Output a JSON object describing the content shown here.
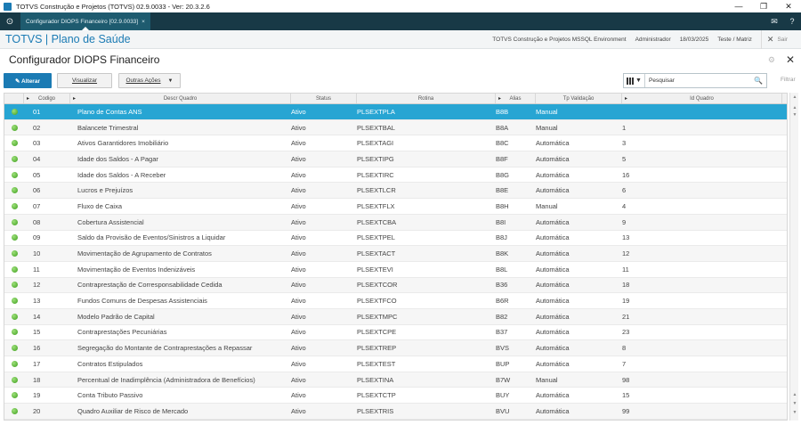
{
  "window": {
    "title": "TOTVS Construção e Projetos (TOTVS) 02.9.0033 - Ver: 20.3.2.6",
    "minimize": "—",
    "maximize": "❐",
    "close": "✕"
  },
  "tabbar": {
    "home_glyph": "⊙",
    "tab_label": "Configurador DIOPS Financeiro [02.9.0033]",
    "tab_close": "×",
    "mail_glyph": "✉",
    "help_glyph": "?"
  },
  "appbar": {
    "brand": "TOTVS | Plano de Saúde",
    "environment": "TOTVS Construção e Projetos MSSQL Environment",
    "user": "Administrador",
    "date": "18/03/2025",
    "branch": "Teste / Matriz",
    "exit_glyph": "✕",
    "exit_label": "Sair"
  },
  "page": {
    "title": "Configurador DIOPS Financeiro",
    "gear_glyph": "⚙",
    "close_glyph": "✕"
  },
  "toolbar": {
    "alterar": "✎ Alterar",
    "visualizar": "Visualizar",
    "outras_acoes": "Outras Ações",
    "caret": "▼",
    "search_placeholder": "Pesquisar",
    "search_glyph": "🔍",
    "filtrar": "Filtrar"
  },
  "grid": {
    "headers": {
      "codigo": "Codigo",
      "descr": "Descr Quadro",
      "status": "Status",
      "rotina": "Rotina",
      "alias": "Alias",
      "tp": "Tp Validação",
      "id": "Id Quadro"
    },
    "rows": [
      {
        "codigo": "01",
        "descr": "Plano de Contas ANS",
        "status": "Ativo",
        "rotina": "PLSEXTPLA",
        "alias": "B8B",
        "tp": "Manual",
        "id": ""
      },
      {
        "codigo": "02",
        "descr": "Balancete Trimestral",
        "status": "Ativo",
        "rotina": "PLSEXTBAL",
        "alias": "B8A",
        "tp": "Manual",
        "id": "1"
      },
      {
        "codigo": "03",
        "descr": "Ativos Garantidores Imobiliário",
        "status": "Ativo",
        "rotina": "PLSEXTAGI",
        "alias": "B8C",
        "tp": "Automática",
        "id": "3"
      },
      {
        "codigo": "04",
        "descr": "Idade dos Saldos - A Pagar",
        "status": "Ativo",
        "rotina": "PLSEXTIPG",
        "alias": "B8F",
        "tp": "Automática",
        "id": "5"
      },
      {
        "codigo": "05",
        "descr": "Idade dos Saldos - A Receber",
        "status": "Ativo",
        "rotina": "PLSEXTIRC",
        "alias": "B8G",
        "tp": "Automática",
        "id": "16"
      },
      {
        "codigo": "06",
        "descr": "Lucros e Prejuízos",
        "status": "Ativo",
        "rotina": "PLSEXTLCR",
        "alias": "B8E",
        "tp": "Automática",
        "id": "6"
      },
      {
        "codigo": "07",
        "descr": "Fluxo de Caixa",
        "status": "Ativo",
        "rotina": "PLSEXTFLX",
        "alias": "B8H",
        "tp": "Manual",
        "id": "4"
      },
      {
        "codigo": "08",
        "descr": "Cobertura Assistencial",
        "status": "Ativo",
        "rotina": "PLSEXTCBA",
        "alias": "B8I",
        "tp": "Automática",
        "id": "9"
      },
      {
        "codigo": "09",
        "descr": "Saldo da Provisão de Eventos/Sinistros a Liquidar",
        "status": "Ativo",
        "rotina": "PLSEXTPEL",
        "alias": "B8J",
        "tp": "Automática",
        "id": "13"
      },
      {
        "codigo": "10",
        "descr": "Movimentação de Agrupamento de Contratos",
        "status": "Ativo",
        "rotina": "PLSEXTACT",
        "alias": "B8K",
        "tp": "Automática",
        "id": "12"
      },
      {
        "codigo": "11",
        "descr": "Movimentação de Eventos Indenizáveis",
        "status": "Ativo",
        "rotina": "PLSEXTEVI",
        "alias": "B8L",
        "tp": "Automática",
        "id": "11"
      },
      {
        "codigo": "12",
        "descr": "Contraprestação de Corresponsabilidade Cedida",
        "status": "Ativo",
        "rotina": "PLSEXTCOR",
        "alias": "B36",
        "tp": "Automática",
        "id": "18"
      },
      {
        "codigo": "13",
        "descr": "Fundos Comuns de Despesas Assistenciais",
        "status": "Ativo",
        "rotina": "PLSEXTFCO",
        "alias": "B6R",
        "tp": "Automática",
        "id": "19"
      },
      {
        "codigo": "14",
        "descr": "Modelo Padrão de Capital",
        "status": "Ativo",
        "rotina": "PLSEXTMPC",
        "alias": "B82",
        "tp": "Automática",
        "id": "21"
      },
      {
        "codigo": "15",
        "descr": "Contraprestações Pecuniárias",
        "status": "Ativo",
        "rotina": "PLSEXTCPE",
        "alias": "B37",
        "tp": "Automática",
        "id": "23"
      },
      {
        "codigo": "16",
        "descr": "Segregação do Montante de Contraprestações a Repassar",
        "status": "Ativo",
        "rotina": "PLSEXTREP",
        "alias": "BVS",
        "tp": "Automática",
        "id": "8"
      },
      {
        "codigo": "17",
        "descr": "Contratos Estipulados",
        "status": "Ativo",
        "rotina": "PLSEXTEST",
        "alias": "BUP",
        "tp": "Automática",
        "id": "7"
      },
      {
        "codigo": "18",
        "descr": "Percentual de Inadimplência (Administradora de Benefícios)",
        "status": "Ativo",
        "rotina": "PLSEXTINA",
        "alias": "B7W",
        "tp": "Manual",
        "id": "98"
      },
      {
        "codigo": "19",
        "descr": "Conta Tributo Passivo",
        "status": "Ativo",
        "rotina": "PLSEXTCTP",
        "alias": "BUY",
        "tp": "Automática",
        "id": "15"
      },
      {
        "codigo": "20",
        "descr": "Quadro Auxiliar de Risco de Mercado",
        "status": "Ativo",
        "rotina": "PLSEXTRIS",
        "alias": "BVU",
        "tp": "Automática",
        "id": "99"
      }
    ]
  },
  "colors": {
    "brand": "#1b7bb4",
    "selected_row": "#27a5d3",
    "tabbar": "#183946",
    "status_active": "#3f9f1e"
  }
}
